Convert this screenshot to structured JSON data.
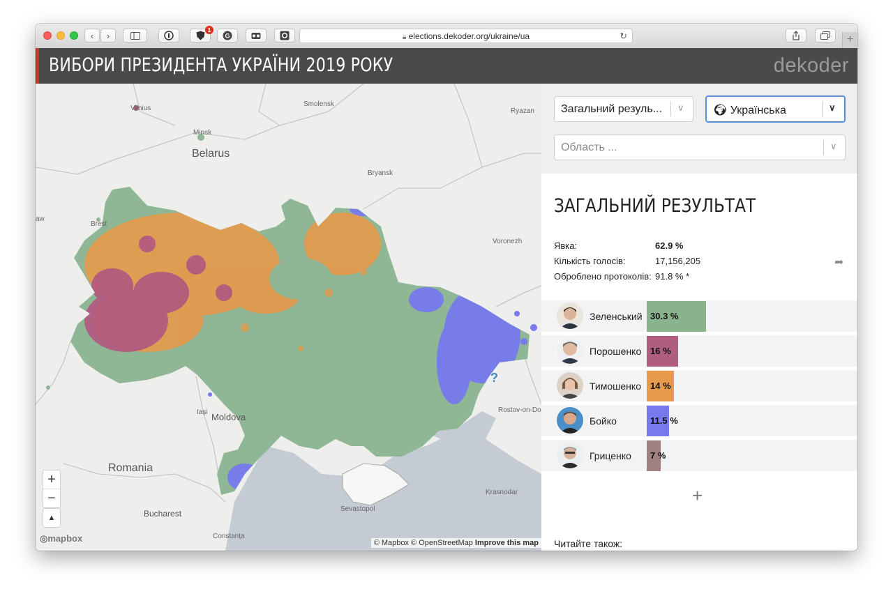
{
  "browser": {
    "url": "elections.dekoder.org/ukraine/ua",
    "extension_badge": "1"
  },
  "header": {
    "title": "ВИБОРИ ПРЕЗИДЕНТА УКРАЇНИ 2019 РОКУ",
    "logo": "dekoder"
  },
  "controls": {
    "result_select": "Загальний резуль...",
    "language_select": "Українська",
    "region_placeholder": "Область ..."
  },
  "results": {
    "title": "ЗАГАЛЬНИЙ РЕЗУЛЬТАТ",
    "stats": [
      {
        "label": "Явка:",
        "value": "62.9 %"
      },
      {
        "label": "Кількість голосів:",
        "value": "17,156,205"
      },
      {
        "label": "Оброблено протоколів:",
        "value": "91.8 % *"
      }
    ],
    "candidates": [
      {
        "name": "Зеленський",
        "label": "30.3 %",
        "percent": 30.3,
        "color": "#88b38c"
      },
      {
        "name": "Порошенко",
        "label": "16 %",
        "percent": 16,
        "color": "#b05e80"
      },
      {
        "name": "Тимошенко",
        "label": "14 %",
        "percent": 14,
        "color": "#e69a4a"
      },
      {
        "name": "Бойко",
        "label": "11.5 %",
        "percent": 11.5,
        "color": "#7879ec"
      },
      {
        "name": "Гриценко",
        "label": "7 %",
        "percent": 7,
        "color": "#a08080"
      }
    ],
    "more_label": "+",
    "read_also": "Читайте також:"
  },
  "map": {
    "labels": {
      "vilnius": "Vilnius",
      "smolensk": "Smolensk",
      "ryazan": "Ryazan",
      "minsk": "Minsk",
      "belarus": "Belarus",
      "bryansk": "Bryansk",
      "brest": "Brest",
      "voronezh": "Voronezh",
      "iasi": "Iași",
      "moldova": "Moldova",
      "rostov": "Rostov-on-Don",
      "romania": "Romania",
      "krasnodar": "Krasnodar",
      "bucharest": "Bucharest",
      "sevastopol": "Sevastopol",
      "constanta": "Constanța",
      "aw": "aw"
    },
    "mapbox_logo": "mapbox",
    "attribution": "© Mapbox © OpenStreetMap",
    "improve": "Improve this map",
    "zoom_in": "+",
    "zoom_out": "−",
    "compass": "▲"
  }
}
